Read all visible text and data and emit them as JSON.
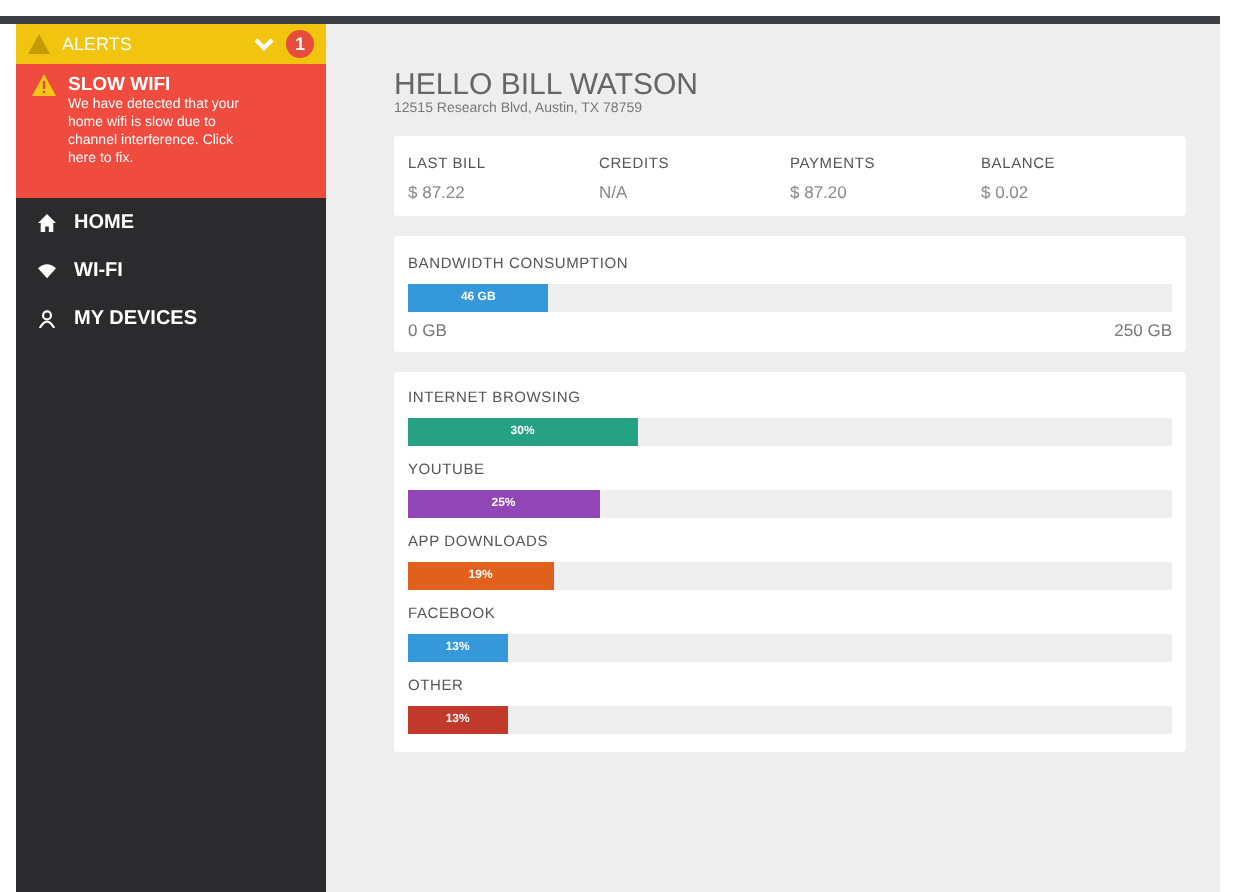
{
  "sidebar": {
    "alerts": {
      "label": "ALERTS",
      "expanded": true,
      "count": "1"
    },
    "alert": {
      "title": "SLOW WIFI",
      "message": "We have detected that your home wifi is slow due to channel interference. Click here to fix."
    },
    "items": [
      {
        "label": "HOME",
        "kind": "home"
      },
      {
        "label": "WI-FI",
        "kind": "wifi"
      },
      {
        "label": "MY DEVICES",
        "kind": "devices"
      }
    ]
  },
  "header": {
    "title": "HELLO BILL WATSON",
    "address": "12515 Research Blvd, Austin, TX 78759"
  },
  "summary": [
    {
      "label": "LAST BILL",
      "value": "$ 87.22"
    },
    {
      "label": "CREDITS",
      "value": "N/A"
    },
    {
      "label": "PAYMENTS",
      "value": "$ 87.20"
    },
    {
      "label": "BALANCE",
      "value": "$ 0.02"
    }
  ],
  "bandwidth": {
    "title": "BANDWIDTH CONSUMPTION",
    "level": 0.184,
    "reading": "46 GB",
    "min": "0 GB",
    "max": "250 GB"
  },
  "usage": [
    {
      "label": "INTERNET BROWSING",
      "level": 0.3,
      "reading": "30%",
      "color": "#26a184"
    },
    {
      "label": "YOUTUBE",
      "level": 0.25,
      "reading": "25%",
      "color": "#9146b8"
    },
    {
      "label": "APP DOWNLOADS",
      "level": 0.19,
      "reading": "19%",
      "color": "#e0601c"
    },
    {
      "label": "FACEBOOK",
      "level": 0.13,
      "reading": "13%",
      "color": "#3598db"
    },
    {
      "label": "OTHER",
      "level": 0.13,
      "reading": "13%",
      "color": "#c0392b"
    }
  ]
}
